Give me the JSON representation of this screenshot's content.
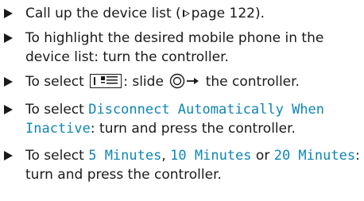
{
  "steps": [
    {
      "before": "Call up the device list (",
      "page_ref": "page 122",
      "after": ")."
    },
    {
      "text": "To highlight the desired mobile phone in the device list: turn the controller."
    },
    {
      "before": "To select ",
      "menu_icon": "menu-list-icon",
      "middle": ": slide ",
      "controller_icon": "controller-slide-right-icon",
      "after": " the controller."
    },
    {
      "before": "To select ",
      "option": "Disconnect Automatically When Inactive",
      "after": ": turn and press the controller."
    },
    {
      "before": "To select ",
      "opt1": "5 Minutes",
      "sep1": ", ",
      "opt2": "10 Minutes",
      "sep2": " or ",
      "opt3": "20 Minutes",
      "after": ": turn and press the controller."
    }
  ],
  "colors": {
    "highlight": "#0f86b2",
    "text": "#1a1a1a"
  }
}
